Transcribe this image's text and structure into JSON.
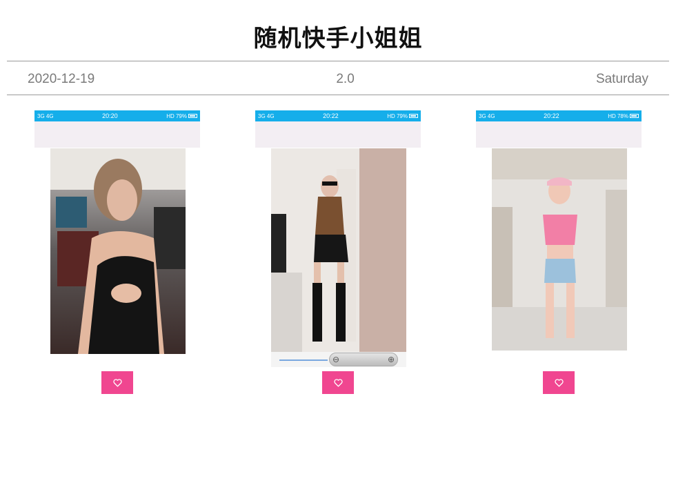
{
  "header": {
    "title": "随机快手小姐姐",
    "date": "2020-12-19",
    "version": "2.0",
    "weekday": "Saturday"
  },
  "theme": {
    "accent_pink": "#f04690",
    "statusbar_blue": "#15aeea",
    "divider_gray": "#9a9a9a",
    "info_text_gray": "#7a7a7a"
  },
  "cards": [
    {
      "status_left": "3G 4G",
      "status_time": "20:20",
      "status_right": "HD 79%",
      "like_icon": "heart-outline-icon"
    },
    {
      "status_left": "3G 4G",
      "status_time": "20:22",
      "status_right": "HD 79%",
      "like_icon": "heart-outline-icon",
      "zoom_out_icon": "zoom-out-icon",
      "zoom_in_icon": "zoom-in-icon"
    },
    {
      "status_left": "3G 4G",
      "status_time": "20:22",
      "status_right": "HD 78%",
      "like_icon": "heart-outline-icon"
    }
  ]
}
